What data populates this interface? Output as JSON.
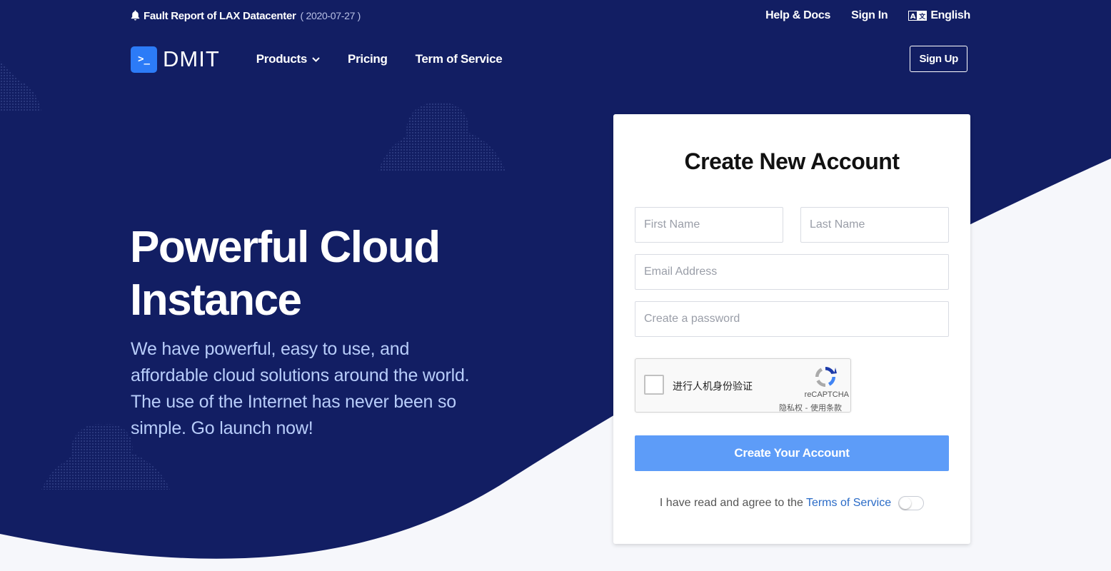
{
  "colors": {
    "navy": "#121e63",
    "accent": "#2c7bf7",
    "button": "#5d9cf8",
    "light_bg": "#f6f7fb"
  },
  "notice": {
    "icon": "bell-icon",
    "text": "Fault Report of LAX Datacenter",
    "date": "( 2020-07-27 )"
  },
  "toplinks": {
    "help": "Help & Docs",
    "signin": "Sign In",
    "language": "English",
    "language_icon": "translate-icon"
  },
  "logo": {
    "mark": ">_",
    "text": "DMIT"
  },
  "nav": {
    "products": "Products",
    "pricing": "Pricing",
    "terms": "Term of Service",
    "signup": "Sign Up"
  },
  "hero": {
    "title": "Powerful Cloud Instance",
    "description": "We have powerful, easy to use, and affordable cloud solutions around the world. The use of the Internet has never been so simple. Go launch now!"
  },
  "form": {
    "title": "Create New Account",
    "first_name_placeholder": "First Name",
    "last_name_placeholder": "Last Name",
    "email_placeholder": "Email Address",
    "password_placeholder": "Create a password",
    "captcha": {
      "label": "进行人机身份验证",
      "brand": "reCAPTCHA",
      "links": "隐私权 - 使用条款"
    },
    "submit": "Create Your Account",
    "agree_text": "I have read and agree to the",
    "agree_link": "Terms of Service",
    "agree_toggle_on": false
  }
}
